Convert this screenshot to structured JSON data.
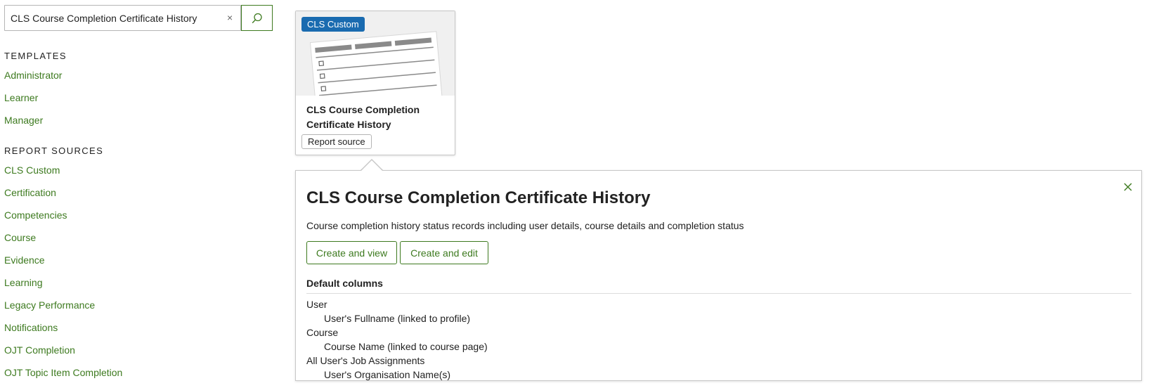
{
  "search": {
    "value": "CLS Course Completion Certificate History",
    "clear_label": "×"
  },
  "sidebar": {
    "templates_heading": "TEMPLATES",
    "templates": [
      "Administrator",
      "Learner",
      "Manager"
    ],
    "sources_heading": "REPORT SOURCES",
    "sources": [
      "CLS Custom",
      "Certification",
      "Competencies",
      "Course",
      "Evidence",
      "Learning",
      "Legacy Performance",
      "Notifications",
      "OJT Completion",
      "OJT Topic Item Completion"
    ]
  },
  "card": {
    "badge": "CLS Custom",
    "title": "CLS Course Completion Certificate History",
    "tag": "Report source"
  },
  "panel": {
    "title": "CLS Course Completion Certificate History",
    "description": "Course completion history status records including user details, course details and completion status",
    "create_view_label": "Create and view",
    "create_edit_label": "Create and edit",
    "columns_heading": "Default columns",
    "column_groups": [
      {
        "group": "User",
        "items": [
          "User's Fullname (linked to profile)"
        ]
      },
      {
        "group": "Course",
        "items": [
          "Course Name (linked to course page)"
        ]
      },
      {
        "group": "All User's Job Assignments",
        "items": [
          "User's Organisation Name(s)"
        ]
      }
    ]
  },
  "colors": {
    "link_green": "#3d7a1f",
    "badge_blue": "#1a6bb0"
  },
  "icons": {
    "search": "search-icon",
    "close": "close-icon"
  }
}
